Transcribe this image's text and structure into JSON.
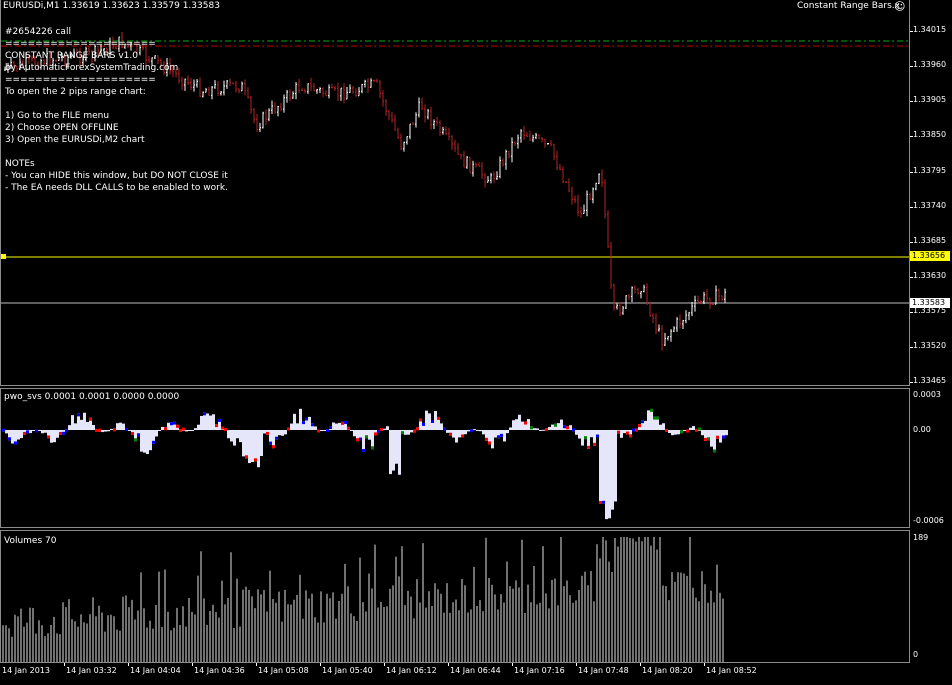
{
  "header": {
    "symbol_info": "EURUSDi,M1  1.33619 1.33623 1.33579 1.33583",
    "ea_name": "Constant Range Bars.x",
    "smiley": "☺"
  },
  "ea_comment": {
    "lines": [
      "#2654226 call",
      "====================",
      "  CONSTANT RANGE BARS v1.0",
      "  by AutomaticForexSystemTrading.com",
      "====================",
      "To open the 2 pips range chart:",
      "",
      "  1) Go to the FILE menu",
      "  2) Choose OPEN OFFLINE",
      "  3) Open the EURUSDi,M2 chart",
      "",
      "NOTEs",
      "  - You can HIDE this window, but DO NOT CLOSE it",
      "  - The EA needs DLL CALLS to be enabled to work."
    ]
  },
  "price_scale": {
    "ticks": [
      "1.34015",
      "1.33960",
      "1.33905",
      "1.33850",
      "1.33795",
      "1.33740",
      "1.33685",
      "1.33630",
      "1.33575",
      "1.33520",
      "1.33465"
    ],
    "yellow_line_label": "1.33656",
    "bid_label": "1.33583"
  },
  "oscillator": {
    "title": "pwo_svs 0.0001 0.0001 0.0000 0.0000",
    "ticks": [
      "0.0003",
      "0.00",
      "-0.0006"
    ]
  },
  "volumes": {
    "title": "Volumes 70",
    "ticks": [
      "189",
      "0"
    ]
  },
  "time_axis": {
    "labels": [
      "14 Jan 2013",
      "14 Jan 03:32",
      "14 Jan 04:04",
      "14 Jan 04:36",
      "14 Jan 05:08",
      "14 Jan 05:40",
      "14 Jan 06:12",
      "14 Jan 06:44",
      "14 Jan 07:16",
      "14 Jan 07:48",
      "14 Jan 08:20",
      "14 Jan 08:52"
    ]
  },
  "colors": {
    "background": "#000000",
    "bull_bar": "#ffffff",
    "bear_bar": "#b22222",
    "yellow_line": "#ffff00",
    "bid_line": "#c0c0c0",
    "osc_fill": "#e6e6fa",
    "osc_red": "#ff0000",
    "osc_blue": "#0000ff",
    "osc_green": "#008000",
    "dash_green": "#00aa00",
    "dash_red": "#cc0000"
  }
}
